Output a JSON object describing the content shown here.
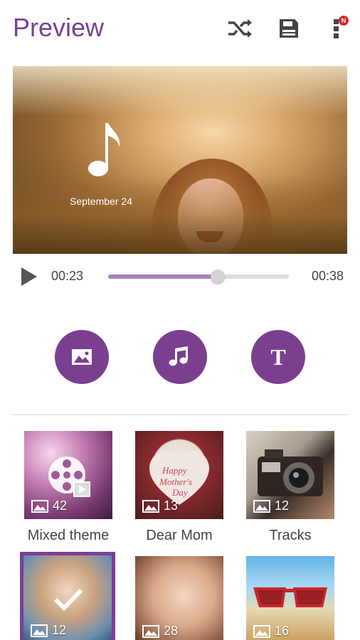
{
  "header": {
    "title": "Preview",
    "shuffle_icon": "shuffle-icon",
    "save_icon": "save-icon",
    "menu_icon": "overflow-menu-icon",
    "notification_badge": "N"
  },
  "preview": {
    "date": "September 24",
    "overlay_icon": "music-note-icon"
  },
  "playback": {
    "current_time": "00:23",
    "total_time": "00:38",
    "progress": 0.605
  },
  "actions": [
    {
      "name": "add-image",
      "icon": "image-icon"
    },
    {
      "name": "add-music",
      "icon": "music-icon"
    },
    {
      "name": "add-text",
      "icon": "text-icon",
      "glyph": "T"
    }
  ],
  "themes": [
    {
      "label": "Mixed theme",
      "count": "42",
      "selected": false
    },
    {
      "label": "Dear Mom",
      "count": "13",
      "selected": false
    },
    {
      "label": "Tracks",
      "count": "12",
      "selected": false
    },
    {
      "label": "",
      "count": "12",
      "selected": true
    },
    {
      "label": "",
      "count": "28",
      "selected": false
    },
    {
      "label": "",
      "count": "16",
      "selected": false
    }
  ],
  "colors": {
    "accent": "#7a3f96",
    "progress_fill": "#a884bd",
    "badge": "#d8232a"
  }
}
